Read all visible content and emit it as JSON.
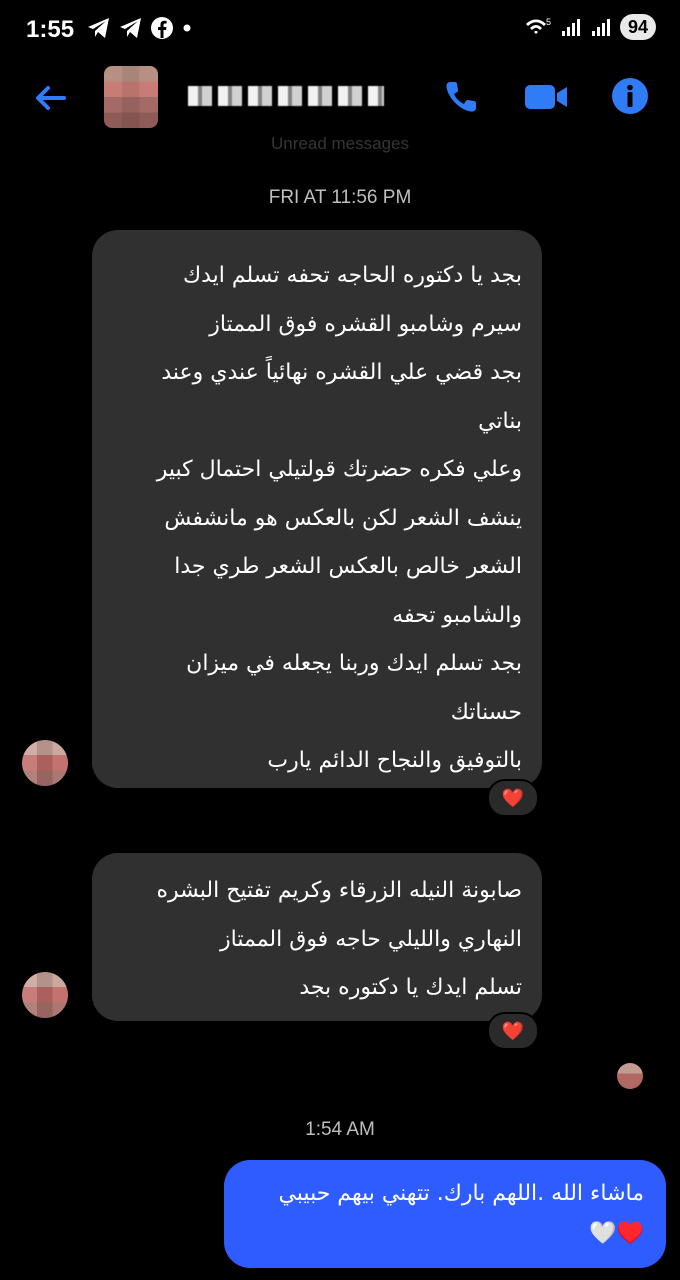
{
  "status_bar": {
    "time": "1:55",
    "battery": "94",
    "network": "5"
  },
  "header": {
    "back_icon": "back-arrow-icon",
    "call_icon": "phone-icon",
    "video_icon": "video-camera-icon",
    "info_icon": "info-icon",
    "accent_color": "#2f7cf6"
  },
  "chat": {
    "unread_divider": "Unread messages",
    "timestamp_1": "FRI AT 11:56 PM",
    "message_1_lines": [
      "بجد يا دكتوره الحاجه تحفه تسلم ايدك",
      "سيرم وشامبو القشره فوق الممتاز",
      "بجد قضي علي القشره نهائياً عندي وعند",
      "بناتي",
      "وعلي فكره حضرتك قولتيلي احتمال كبير",
      "ينشف الشعر لكن بالعكس هو مانشفش",
      "الشعر خالص بالعكس الشعر طري جدا",
      "والشامبو تحفه",
      "بجد تسلم ايدك وربنا يجعله في ميزان",
      "حسناتك",
      "بالتوفيق والنجاح الدائم يارب"
    ],
    "message_1_reaction": "❤️",
    "message_2_lines": [
      "صابونة النيله الزرقاء وكريم تفتيح البشره",
      "النهاري والليلي حاجه فوق الممتاز",
      "تسلم ايدك يا دكتوره بجد"
    ],
    "message_2_reaction": "❤️",
    "timestamp_2": "1:54 AM",
    "sent_lines": [
      "ماشاء الله .اللهم بارك. تتهني بيهم حبيبي",
      "♥️🤍"
    ],
    "sent_color": "#2e5cff"
  }
}
